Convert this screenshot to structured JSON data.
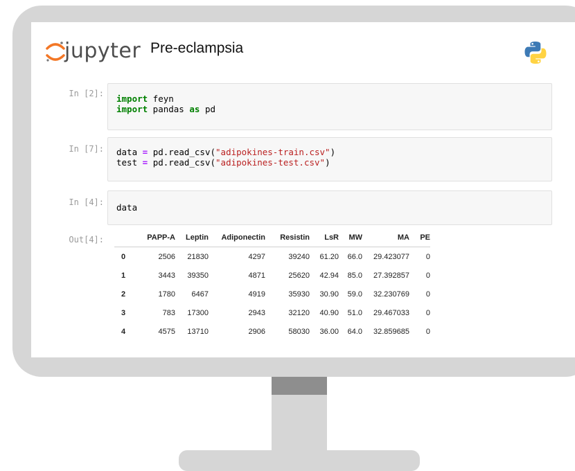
{
  "header": {
    "logo_text": "jupyter",
    "notebook_title": "Pre-eclampsia"
  },
  "cells": [
    {
      "prompt": "In [2]:",
      "lines": [
        [
          [
            "kw",
            "import"
          ],
          [
            "t",
            " feyn"
          ]
        ],
        [
          [
            "kw",
            "import"
          ],
          [
            "t",
            " pandas "
          ],
          [
            "kw",
            "as"
          ],
          [
            "t",
            " pd"
          ]
        ]
      ]
    },
    {
      "prompt": "In [7]:",
      "lines": [
        [
          [
            "t",
            "data "
          ],
          [
            "op",
            "="
          ],
          [
            "t",
            " pd.read_csv("
          ],
          [
            "str",
            "\"adipokines-train.csv\""
          ],
          [
            "t",
            ")"
          ]
        ],
        [
          [
            "t",
            "test "
          ],
          [
            "op",
            "="
          ],
          [
            "t",
            " pd.read_csv("
          ],
          [
            "str",
            "\"adipokines-test.csv\""
          ],
          [
            "t",
            ")"
          ]
        ]
      ]
    },
    {
      "prompt": "In [4]:",
      "lines": [
        [
          [
            "t",
            "data"
          ]
        ]
      ]
    }
  ],
  "output": {
    "prompt": "Out[4]:",
    "columns": [
      "",
      "PAPP-A",
      "Leptin",
      "Adiponectin",
      "Resistin",
      "LsR",
      "MW",
      "MA",
      "PE"
    ],
    "rows": [
      [
        "0",
        "2506",
        "21830",
        "4297",
        "39240",
        "61.20",
        "66.0",
        "29.423077",
        "0"
      ],
      [
        "1",
        "3443",
        "39350",
        "4871",
        "25620",
        "42.94",
        "85.0",
        "27.392857",
        "0"
      ],
      [
        "2",
        "1780",
        "6467",
        "4919",
        "35930",
        "30.90",
        "59.0",
        "32.230769",
        "0"
      ],
      [
        "3",
        "783",
        "17300",
        "2943",
        "32120",
        "40.90",
        "51.0",
        "29.467033",
        "0"
      ],
      [
        "4",
        "4575",
        "13710",
        "2906",
        "58030",
        "36.00",
        "64.0",
        "32.859685",
        "0"
      ]
    ]
  },
  "colors": {
    "monitor": "#d6d6d6",
    "keyword": "#008000",
    "string": "#ba2121",
    "operator": "#aa22ff",
    "jupyter_orange": "#f37726"
  }
}
